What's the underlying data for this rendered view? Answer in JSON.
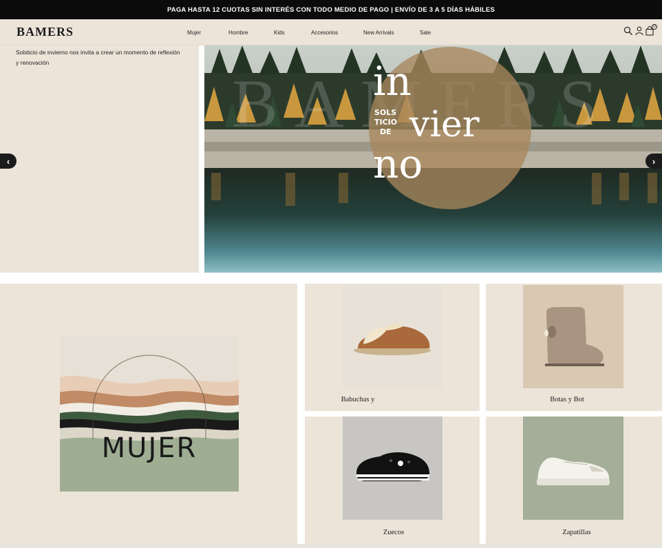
{
  "announcement": "PAGA HASTA 12 CUOTAS SIN INTERÉS CON TODO MEDIO DE PAGO | ENVÍO DE 3 A 5 DÍAS HÁBILES",
  "header": {
    "logo": "BAMERS",
    "nav": [
      "Mujer",
      "Hombre",
      "Kids",
      "Accesorios",
      "New Arrivals",
      "Sale"
    ],
    "cart_count": "0"
  },
  "hero": {
    "text": "Solsticio de invierno nos invita a crear un momento de reflexión y renovación",
    "title_big_1": "in",
    "title_big_2": "vier",
    "title_big_3": "no",
    "title_small_1": "SOLS",
    "title_small_2": "TICIO",
    "title_small_3": "DE",
    "watermark": "BAMERS",
    "prev_glyph": "‹",
    "next_glyph": "›"
  },
  "categories": {
    "mujer": "MUJER",
    "items": [
      "Babuchas y",
      "Botas y Bot",
      "Zuecos",
      "Zapatillas"
    ]
  },
  "colors": {
    "beige": "#ece4d9",
    "black": "#0b0b0b",
    "ochre_circle": "#a8865c"
  }
}
